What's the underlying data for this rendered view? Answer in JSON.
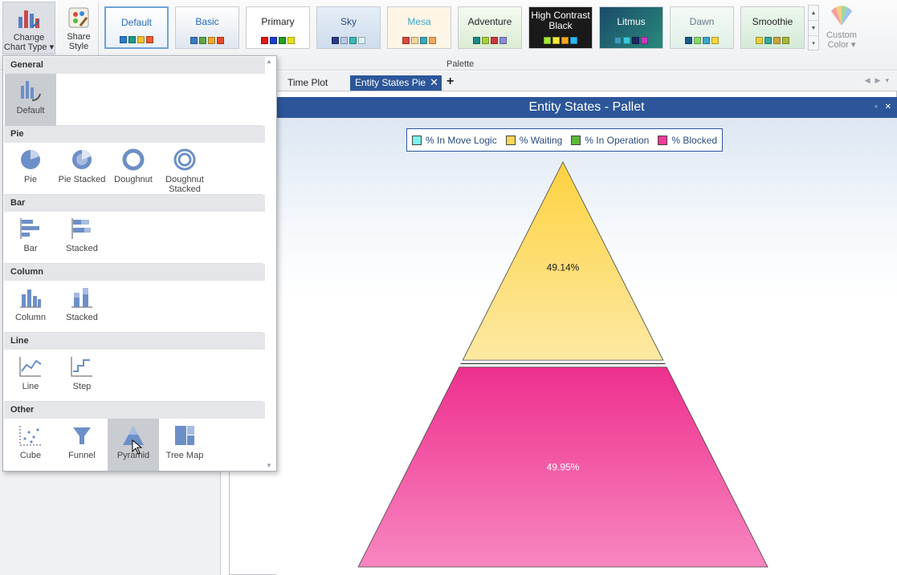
{
  "ribbon": {
    "change_chart_type": "Change Chart Type ▾",
    "share_style": "Share Style",
    "palettes": [
      {
        "name": "Default",
        "swatches": [
          "#2a7bd1",
          "#1e9a8a",
          "#f2c12e",
          "#ef5a2e"
        ]
      },
      {
        "name": "Basic",
        "swatches": [
          "#3b79c2",
          "#5ea84a",
          "#f0a830",
          "#e84a2a"
        ]
      },
      {
        "name": "Primary",
        "swatches": [
          "#e01818",
          "#1a3ecf",
          "#22a022",
          "#e8e018"
        ]
      },
      {
        "name": "Sky",
        "swatches": [
          "#2a3a8a",
          "#b8c8ee",
          "#3abaae",
          "#d8f4f4"
        ]
      },
      {
        "name": "Mesa",
        "swatches": [
          "#d84a3a",
          "#f4d89a",
          "#3aaab6",
          "#f4a65a"
        ]
      },
      {
        "name": "Adventure",
        "swatches": [
          "#1a8a8a",
          "#a8d03a",
          "#c83a3a",
          "#8a8ad8"
        ]
      },
      {
        "name": "High Contrast Black",
        "swatches": [
          "#a8e83a",
          "#f8e83a",
          "#f8a81a",
          "#2ab8f8"
        ]
      },
      {
        "name": "Litmus",
        "swatches": [
          "#3a9ab8",
          "#3ac8d8",
          "#1a2a6a",
          "#c83ab8"
        ]
      },
      {
        "name": "Dawn",
        "swatches": [
          "#1a5a8a",
          "#8ad86a",
          "#3aa8c8",
          "#f8d83a"
        ]
      },
      {
        "name": "Smoothie",
        "swatches": [
          "#e8d03a",
          "#3aa89a",
          "#c8a83a",
          "#a8b83a"
        ]
      }
    ],
    "custom_color": "Custom Color ▾",
    "palette_caption": "Palette"
  },
  "tabs": {
    "time_plot": "Time Plot",
    "entity_states_pie": "Entity States Pie",
    "close": "✕",
    "add": "+"
  },
  "chart_window": {
    "title": "Entity States - Pallet",
    "controls": "▫ ✕"
  },
  "chart_type_menu": {
    "groups": [
      {
        "header": "General",
        "items": [
          "Default"
        ]
      },
      {
        "header": "Pie",
        "items": [
          "Pie",
          "Pie Stacked",
          "Doughnut",
          "Doughnut Stacked"
        ]
      },
      {
        "header": "Bar",
        "items": [
          "Bar",
          "Stacked"
        ]
      },
      {
        "header": "Column",
        "items": [
          "Column",
          "Stacked"
        ]
      },
      {
        "header": "Line",
        "items": [
          "Line",
          "Step"
        ]
      },
      {
        "header": "Other",
        "items": [
          "Cube",
          "Funnel",
          "Pyramid",
          "Tree Map"
        ]
      }
    ],
    "hovered": "Pyramid"
  },
  "chart_data": {
    "type": "pyramid",
    "title": "Entity States - Pallet",
    "legend_position": "top",
    "series": [
      {
        "name": "% In Move Logic",
        "value": 0.0,
        "color": "#7ff0ee"
      },
      {
        "name": "% Waiting",
        "value": 49.14,
        "color": "#fbd45a"
      },
      {
        "name": "% In Operation",
        "value": 0.91,
        "color": "#5ab83a"
      },
      {
        "name": "% Blocked",
        "value": 49.95,
        "color": "#f23a9a"
      }
    ],
    "data_labels": [
      "49.14%",
      "49.95%"
    ]
  }
}
